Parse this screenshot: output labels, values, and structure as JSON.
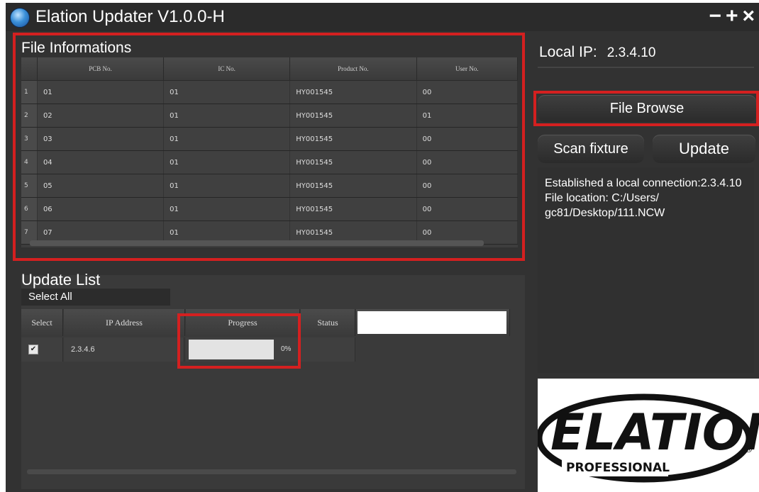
{
  "window": {
    "title": "Elation Updater V1.0.0-H",
    "minimize_label": "−",
    "maximize_label": "+",
    "close_label": "×"
  },
  "file_info": {
    "title": "File Informations",
    "columns": [
      "PCB No.",
      "IC No.",
      "Product No.",
      "User No."
    ],
    "rows": [
      {
        "n": "1",
        "pcb": "01",
        "ic": "01",
        "product": "HY001545",
        "user": "00"
      },
      {
        "n": "2",
        "pcb": "02",
        "ic": "01",
        "product": "HY001545",
        "user": "01"
      },
      {
        "n": "3",
        "pcb": "03",
        "ic": "01",
        "product": "HY001545",
        "user": "00"
      },
      {
        "n": "4",
        "pcb": "04",
        "ic": "01",
        "product": "HY001545",
        "user": "00"
      },
      {
        "n": "5",
        "pcb": "05",
        "ic": "01",
        "product": "HY001545",
        "user": "00"
      },
      {
        "n": "6",
        "pcb": "06",
        "ic": "01",
        "product": "HY001545",
        "user": "00"
      },
      {
        "n": "7",
        "pcb": "07",
        "ic": "01",
        "product": "HY001545",
        "user": "00"
      }
    ]
  },
  "network": {
    "local_ip_label": "Local IP:",
    "local_ip": "2.3.4.10"
  },
  "buttons": {
    "file_browse": "File Browse",
    "scan_fixture": "Scan fixture",
    "update": "Update"
  },
  "message": "Established a local connection:2.3.4.10\nFile location: C:/Users/\ngc81/Desktop/111.NCW",
  "update_list": {
    "title": "Update List",
    "select_all": "Select All",
    "columns": {
      "select": "Select",
      "ip": "IP Address",
      "progress": "Progress",
      "status": "Status"
    },
    "row": {
      "checked": true,
      "ip": "2.3.4.6",
      "progress_text": "0%",
      "progress": 0,
      "status": ""
    }
  },
  "logo": {
    "brand": "ELATION",
    "sub": "PROFESSIONAL",
    "mark": "®"
  },
  "colors": {
    "highlight": "#d42020",
    "background": "#323232"
  }
}
